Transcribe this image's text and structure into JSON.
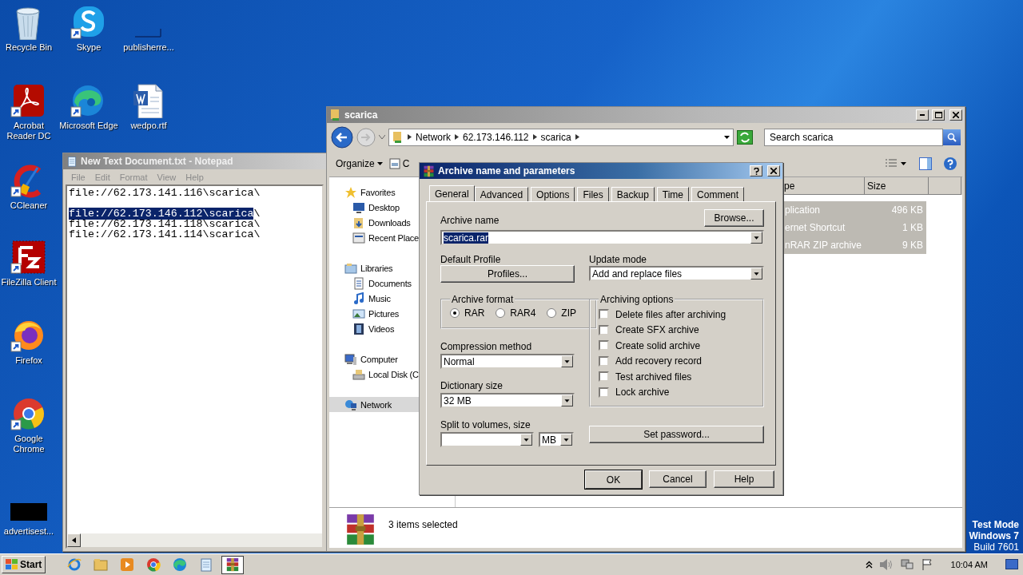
{
  "desktop_icons": [
    {
      "label": "Recycle Bin"
    },
    {
      "label": "Skype"
    },
    {
      "label": "publisherre..."
    },
    {
      "label": "Acrobat Reader DC"
    },
    {
      "label": "Microsoft Edge"
    },
    {
      "label": "wedpo.rtf"
    },
    {
      "label": "CCleaner"
    },
    {
      "label": "FileZilla Client"
    },
    {
      "label": "Firefox"
    },
    {
      "label": "Google Chrome"
    },
    {
      "label": "advertisest..."
    }
  ],
  "notepad": {
    "title": "New Text Document.txt - Notepad",
    "menu": [
      "File",
      "Edit",
      "Format",
      "View",
      "Help"
    ],
    "lines": [
      {
        "kind": "text",
        "text": "file://62.173.141.116\\scarica\\"
      },
      {
        "kind": "blank"
      },
      {
        "kind": "selection",
        "selected_text": "file://62.173.146.112\\scarica",
        "text": "\\"
      },
      {
        "kind": "text",
        "text": "file://62.173.141.118\\scarica\\"
      },
      {
        "kind": "text",
        "text": "file://62.173.141.114\\scarica\\"
      }
    ]
  },
  "explorer": {
    "title": "scarica",
    "breadcrumbs": [
      "Network",
      "62.173.146.112",
      "scarica"
    ],
    "search": {
      "placeholder": "Search scarica"
    },
    "toolbar_buttons": [
      "Organize",
      "C"
    ],
    "nav": [
      {
        "label": "Favorites",
        "selected": false,
        "children": [
          {
            "label": "Desktop",
            "selected": false
          },
          {
            "label": "Downloads",
            "selected": false
          },
          {
            "label": "Recent Place",
            "selected": false
          }
        ]
      },
      {
        "label": "Libraries",
        "selected": false,
        "children": [
          {
            "label": "Documents",
            "selected": false
          },
          {
            "label": "Music",
            "selected": false
          },
          {
            "label": "Pictures",
            "selected": false
          },
          {
            "label": "Videos",
            "selected": false
          }
        ]
      },
      {
        "label": "Computer",
        "selected": false,
        "children": [
          {
            "label": "Local Disk (C",
            "selected": false
          }
        ]
      },
      {
        "label": "Network",
        "selected": true
      }
    ],
    "columns": [
      "pe",
      "Size"
    ],
    "rows": [
      {
        "cells": [
          "plication",
          "496 KB"
        ],
        "selected": true
      },
      {
        "cells": [
          "ernet Shortcut",
          "1 KB"
        ],
        "selected": true
      },
      {
        "cells": [
          "nRAR ZIP archive",
          "9 KB"
        ],
        "selected": true
      }
    ],
    "status": "3 items selected"
  },
  "dialog": {
    "title": "Archive name and parameters",
    "tabs": [
      {
        "label": "General",
        "selected": true
      },
      {
        "label": "Advanced",
        "selected": false
      },
      {
        "label": "Options",
        "selected": false
      },
      {
        "label": "Files",
        "selected": false
      },
      {
        "label": "Backup",
        "selected": false
      },
      {
        "label": "Time",
        "selected": false
      },
      {
        "label": "Comment",
        "selected": false
      }
    ],
    "archive_name": {
      "label": "Archive name",
      "value": "scarica.rar",
      "value_selected": true
    },
    "browse_button": "Browse...",
    "default_profile": {
      "label": "Default Profile",
      "button": "Profiles..."
    },
    "update_mode": {
      "label": "Update mode",
      "value": "Add and replace files"
    },
    "archive_format": {
      "label": "Archive format",
      "options": [
        {
          "label": "RAR",
          "selected": true
        },
        {
          "label": "RAR4",
          "selected": false
        },
        {
          "label": "ZIP",
          "selected": false
        }
      ]
    },
    "archiving_options": {
      "label": "Archiving options",
      "options": [
        {
          "label": "Delete files after archiving",
          "checked": false
        },
        {
          "label": "Create SFX archive",
          "checked": false
        },
        {
          "label": "Create solid archive",
          "checked": false
        },
        {
          "label": "Add recovery record",
          "checked": false
        },
        {
          "label": "Test archived files",
          "checked": false
        },
        {
          "label": "Lock archive",
          "checked": false
        }
      ]
    },
    "compression_method": {
      "label": "Compression method",
      "value": "Normal"
    },
    "dictionary_size": {
      "label": "Dictionary size",
      "value": "32 MB"
    },
    "split_volumes": {
      "label": "Split to volumes, size",
      "unit": "MB"
    },
    "set_password_button": "Set password...",
    "buttons": [
      "OK",
      "Cancel",
      "Help"
    ]
  },
  "taskbar": {
    "start": "Start",
    "buttons": [
      {
        "selected": false
      },
      {
        "selected": false
      },
      {
        "selected": false
      },
      {
        "selected": false
      },
      {
        "selected": false
      },
      {
        "selected": false
      },
      {
        "selected": true
      }
    ],
    "clock": "10:04 AM"
  },
  "system_notice": [
    "Test Mode",
    "Windows 7",
    "Build 7601"
  ]
}
